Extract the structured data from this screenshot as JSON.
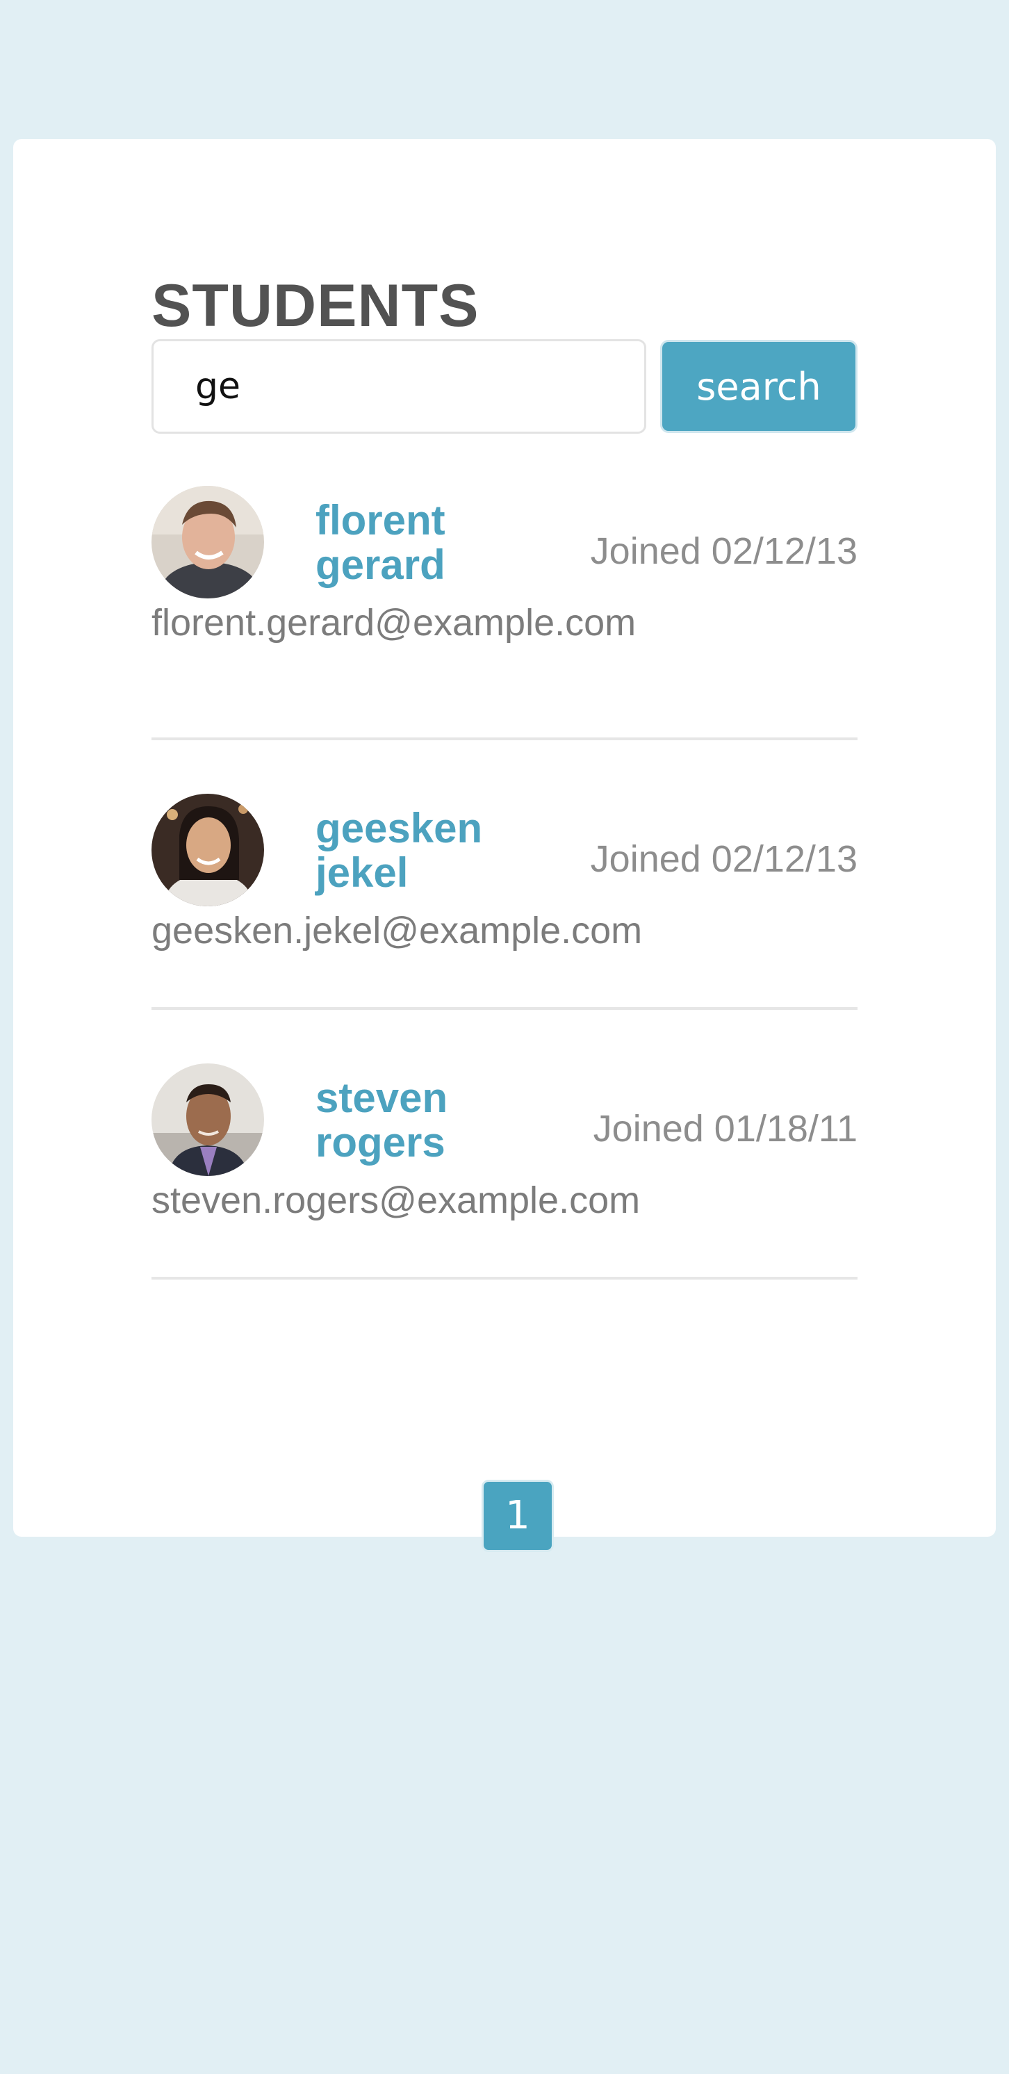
{
  "page": {
    "title": "STUDENTS"
  },
  "search": {
    "value": "ge",
    "button_label": "search"
  },
  "students": [
    {
      "first_name": "florent",
      "last_name": "gerard",
      "joined": "Joined 02/12/13",
      "email": "florent.gerard@example.com",
      "avatar": "avatar-photo"
    },
    {
      "first_name": "geesken",
      "last_name": "jekel",
      "joined": "Joined 02/12/13",
      "email": "geesken.jekel@example.com",
      "avatar": "avatar-photo"
    },
    {
      "first_name": "steven",
      "last_name": "rogers",
      "joined": "Joined 01/18/11",
      "email": "steven.rogers@example.com",
      "avatar": "avatar-photo"
    }
  ],
  "pagination": {
    "current_page": "1"
  },
  "colors": {
    "background": "#e1eff4",
    "accent": "#4da6c2",
    "title": "#525252",
    "muted": "#8d8d8d"
  }
}
